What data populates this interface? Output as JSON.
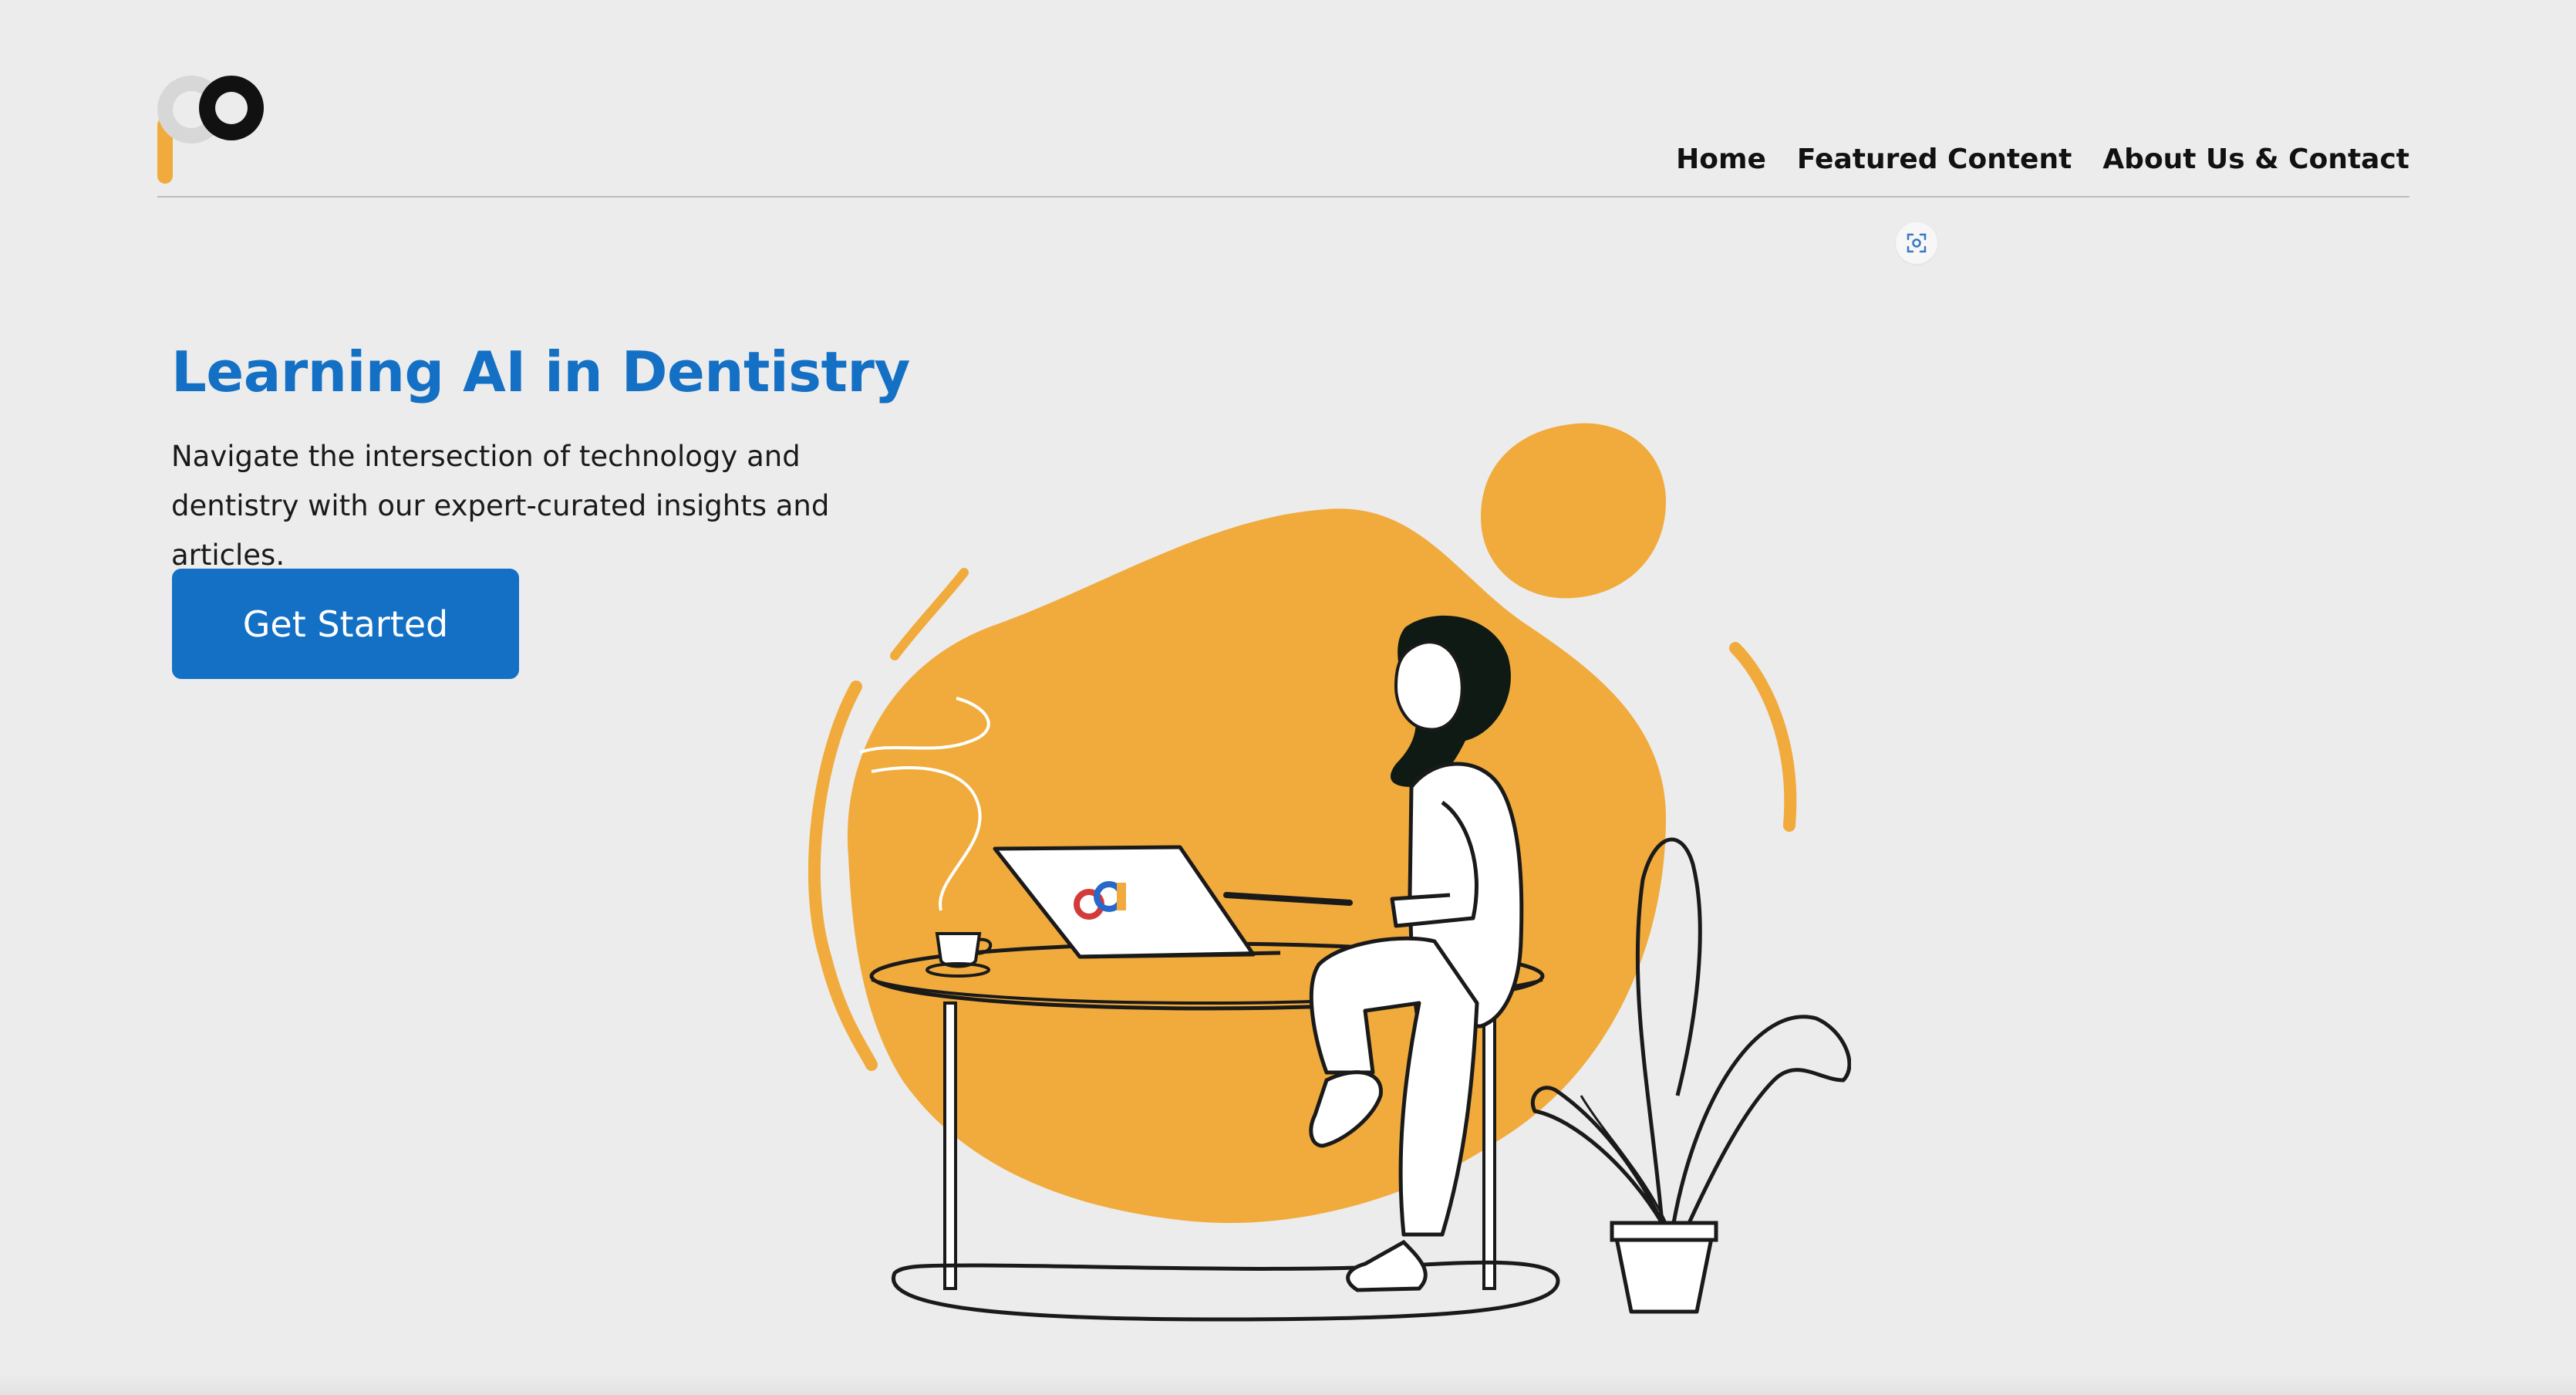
{
  "header": {
    "logo_icon": "brand-logo-icon",
    "nav": [
      {
        "label": "Home"
      },
      {
        "label": "Featured Content"
      },
      {
        "label": "About Us & Contact"
      }
    ]
  },
  "floating_icon": "screenshot-capture-icon",
  "hero": {
    "title": "Learning AI in Dentistry",
    "subtitle": "Navigate the intersection of technology and dentistry with our expert-curated insights and articles.",
    "cta_label": "Get Started",
    "illustration_icon": "person-working-at-laptop-illustration"
  },
  "colors": {
    "background": "#ececec",
    "accent_blue": "#1470c4",
    "accent_orange": "#f0ab3c",
    "text_dark": "#111111"
  }
}
